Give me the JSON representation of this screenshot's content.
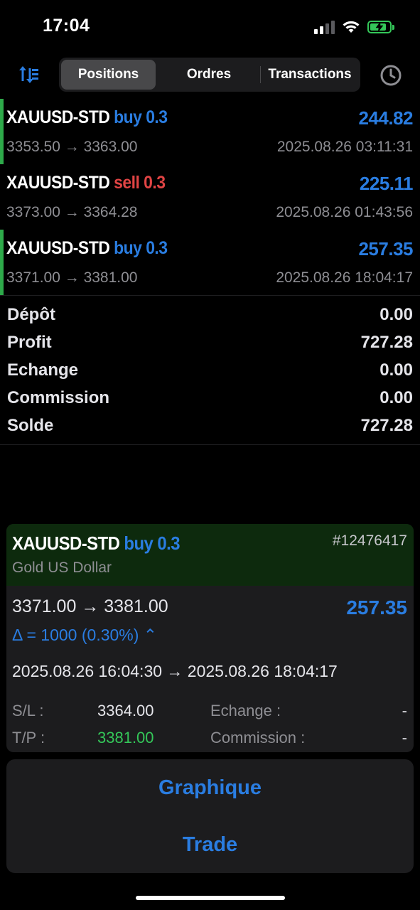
{
  "status_bar": {
    "time": "17:04"
  },
  "tabs": [
    {
      "label": "Positions",
      "active": true
    },
    {
      "label": "Ordres",
      "active": false
    },
    {
      "label": "Transactions",
      "active": false
    }
  ],
  "icons": {
    "sort": "sort-arrows-icon",
    "history": "clock-icon"
  },
  "trades": [
    {
      "symbol": "XAUUSD-STD",
      "side": "buy 0.3",
      "profit": "244.82",
      "prices": "3353.50 → 3363.00",
      "time": "2025.08.26 03:11:31",
      "bar": true
    },
    {
      "symbol": "XAUUSD-STD",
      "side": "sell 0.3",
      "profit": "225.11",
      "prices": "3373.00 → 3364.28",
      "time": "2025.08.26 01:43:56",
      "bar": false
    },
    {
      "symbol": "XAUUSD-STD",
      "side": "buy 0.3",
      "profit": "257.35",
      "prices": "3371.00 → 3381.00",
      "time": "2025.08.26 18:04:17",
      "bar": true
    }
  ],
  "summary": [
    {
      "label": "Dépôt",
      "value": "0.00"
    },
    {
      "label": "Profit",
      "value": "727.28"
    },
    {
      "label": "Echange",
      "value": "0.00"
    },
    {
      "label": "Commission",
      "value": "0.00"
    },
    {
      "label": "Solde",
      "value": "727.28"
    }
  ],
  "detail": {
    "symbol": "XAUUSD-STD",
    "side": "buy 0.3",
    "ticket": "#12476417",
    "description": "Gold US Dollar",
    "prices": "3371.00 → 3381.00",
    "profit": "257.35",
    "delta": "Δ = 1000 (0.30%) ⌃",
    "times": "2025.08.26 16:04:30 → 2025.08.26 18:04:17",
    "sl_label": "S/L :",
    "sl_value": "3364.00",
    "tp_label": "T/P :",
    "tp_value": "3381.00",
    "swap_label": "Echange :",
    "swap_value": "-",
    "commission_label": "Commission :",
    "commission_value": "-"
  },
  "actions": {
    "chart": "Graphique",
    "trade": "Trade"
  },
  "colors": {
    "accent": "#2a7de1",
    "sell": "#e04444",
    "buy_bar": "#2eaa4a",
    "tp": "#34c759",
    "card_head": "#0d2a0d"
  }
}
